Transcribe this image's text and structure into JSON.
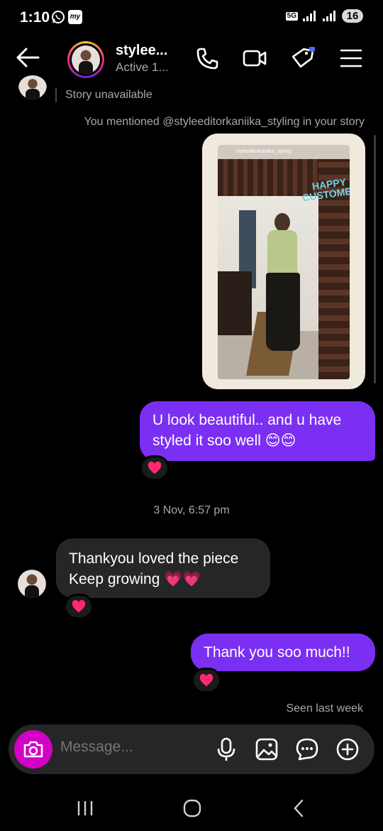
{
  "status_bar": {
    "time": "1:10",
    "network": "5G",
    "battery": "16"
  },
  "header": {
    "username": "stylee...",
    "status": "Active 1..."
  },
  "thread": {
    "story_unavailable": "Story unavailable",
    "mention_note": "You mentioned @styleeditorkaniika_styling in your story",
    "story": {
      "handle": "styleeditorkaniika_styling",
      "overlay_line1": "HAPPY",
      "overlay_line2": "CUSTOMER"
    },
    "messages": [
      {
        "direction": "outgoing",
        "text": "U look beautiful.. and u have styled it soo well 😊😊"
      },
      {
        "direction": "incoming",
        "text": "Thankyou loved the piece Keep growing 💗💗"
      },
      {
        "direction": "outgoing",
        "text": "Thank you soo much!!"
      }
    ],
    "timestamp": "3 Nov, 6:57 pm",
    "seen": "Seen last week"
  },
  "composer": {
    "placeholder": "Message..."
  },
  "colors": {
    "outgoing_bubble": "#7b2ff2",
    "incoming_bubble": "#262626",
    "camera_button": "#d300c5",
    "reaction_heart": "#ff2a6d"
  }
}
